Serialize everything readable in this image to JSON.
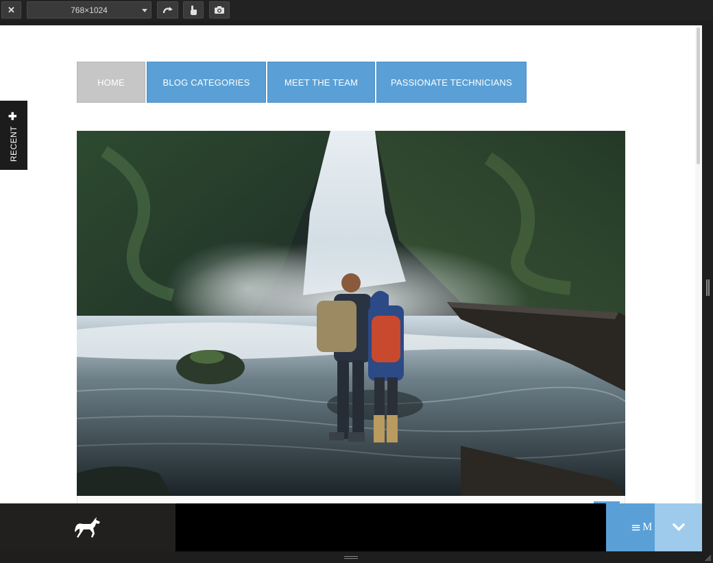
{
  "toolbar": {
    "close_icon": "close-icon",
    "device_size": "768×1024",
    "rotate_icon": "rotate-icon",
    "touch_icon": "touch-icon",
    "screenshot_icon": "camera-icon"
  },
  "nav": {
    "items": [
      {
        "label": "HOME",
        "active": true
      },
      {
        "label": "BLOG CATEGORIES",
        "active": false
      },
      {
        "label": "MEET THE TEAM",
        "active": false
      },
      {
        "label": "PASSIONATE TECHNICIANS",
        "active": false
      }
    ]
  },
  "recent_tab": {
    "label": "RECENT",
    "icon": "plus-icon"
  },
  "hero": {
    "image": "photo of two hikers with backpacks standing before a waterfall"
  },
  "bottombar": {
    "logo_icon": "horse-logo-icon",
    "menu_label": "M",
    "menu_icon": "hamburger-icon",
    "down_icon": "chevron-down-icon"
  },
  "colors": {
    "accent": "#5aa0d6",
    "accent_light": "#9ecbeb",
    "active_nav": "#c6c6c6",
    "bar_dark": "#221f1f"
  }
}
